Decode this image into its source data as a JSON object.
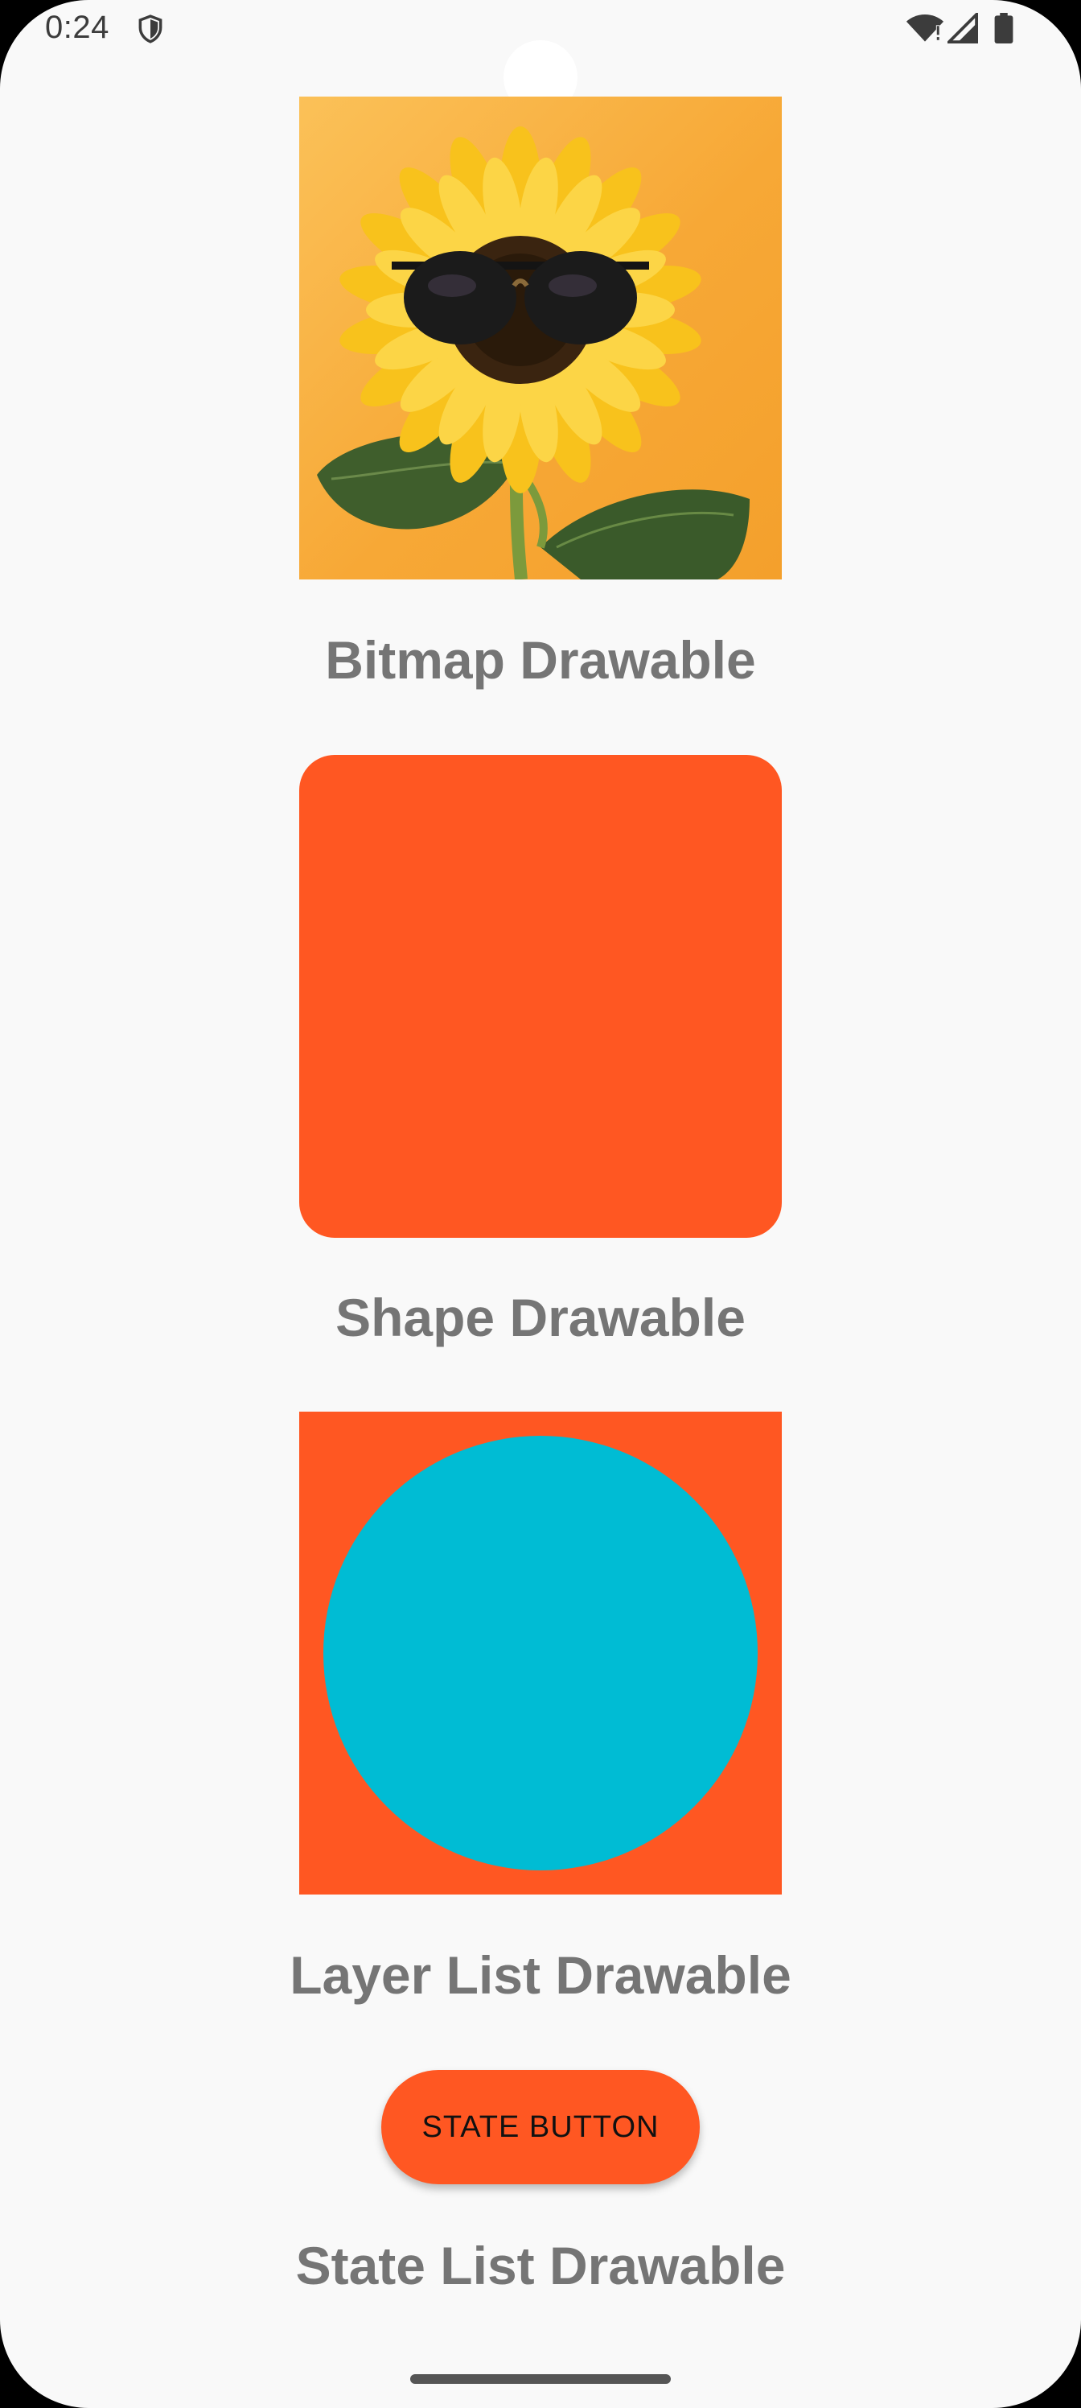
{
  "status_bar": {
    "time": "0:24",
    "icons": [
      "shield-icon",
      "wifi-icon",
      "signal-icon",
      "battery-icon"
    ]
  },
  "drawables": {
    "bitmap": {
      "label": "Bitmap Drawable",
      "image": "sunflower with sunglasses on orange background"
    },
    "shape": {
      "label": "Shape Drawable",
      "color": "#ff5722"
    },
    "layer_list": {
      "label": "Layer List Drawable",
      "background_color": "#ff5722",
      "circle_color": "#00bcd4"
    },
    "state_list": {
      "label": "State List Drawable",
      "button_label": "STATE BUTTON",
      "button_color": "#ff5722"
    }
  },
  "colors": {
    "background": "#f9f9f9",
    "label_text": "#757575",
    "accent": "#ff5722",
    "cyan": "#00bcd4"
  }
}
